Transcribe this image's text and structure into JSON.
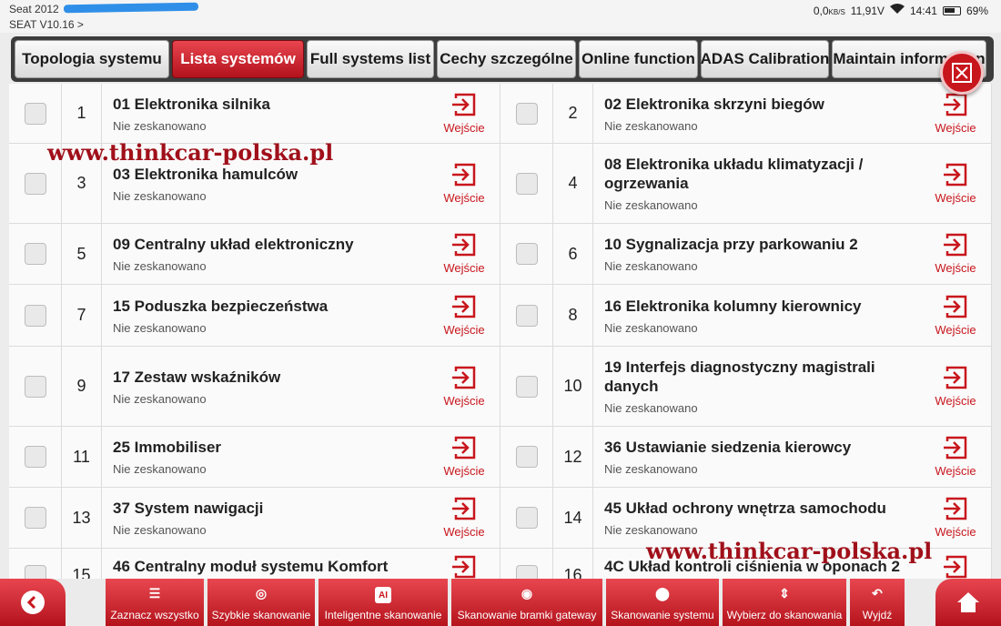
{
  "status_bar": {
    "line1": "Seat  2012",
    "line2": "SEAT V10.16 >",
    "net": "0,0",
    "net_unit": "KB/S",
    "voltage": "11,91V",
    "time": "14:41",
    "battery": "69%"
  },
  "tabs": [
    {
      "label": "Topologia systemu",
      "active": false
    },
    {
      "label": "Lista systemów",
      "active": true
    },
    {
      "label": "Full systems list",
      "active": false
    },
    {
      "label": "Cechy szczególne",
      "active": false
    },
    {
      "label": "Online function",
      "active": false
    },
    {
      "label": "ADAS Calibration",
      "active": false
    },
    {
      "label": "Maintain information",
      "active": false
    }
  ],
  "entry_label": "Wejście",
  "status_label": "Nie zeskanowano",
  "systems": [
    {
      "no": "1",
      "name": "01 Elektronika silnika"
    },
    {
      "no": "2",
      "name": "02 Elektronika skrzyni biegów"
    },
    {
      "no": "3",
      "name": "03 Elektronika hamulców"
    },
    {
      "no": "4",
      "name": "08 Elektronika układu klimatyzacji / ogrzewania"
    },
    {
      "no": "5",
      "name": "09 Centralny układ elektroniczny"
    },
    {
      "no": "6",
      "name": "10 Sygnalizacja przy parkowaniu 2"
    },
    {
      "no": "7",
      "name": "15 Poduszka bezpieczeństwa"
    },
    {
      "no": "8",
      "name": "16 Elektronika kolumny kierownicy"
    },
    {
      "no": "9",
      "name": "17 Zestaw wskaźników"
    },
    {
      "no": "10",
      "name": "19 Interfejs diagnostyczny magistrali danych"
    },
    {
      "no": "11",
      "name": "25 Immobiliser"
    },
    {
      "no": "12",
      "name": "36 Ustawianie siedzenia kierowcy"
    },
    {
      "no": "13",
      "name": "37 System nawigacji"
    },
    {
      "no": "14",
      "name": "45 Układ ochrony wnętrza samochodu"
    },
    {
      "no": "15",
      "name": "46 Centralny moduł systemu Komfort"
    },
    {
      "no": "16",
      "name": "4C Układ kontroli ciśnienia w oponach 2"
    }
  ],
  "watermark": "www.thinkcar-polska.pl",
  "bottom_buttons": [
    {
      "label": "Zaznacz wszystko",
      "icon": "checklist-icon"
    },
    {
      "label": "Szybkie skanowanie",
      "icon": "quick-scan-icon"
    },
    {
      "label": "Inteligentne skanowanie",
      "icon": "ai-icon",
      "glyph": "AI"
    },
    {
      "label": "Skanowanie bramki gateway",
      "icon": "gateway-icon"
    },
    {
      "label": "Skanowanie systemu",
      "icon": "system-scan-icon"
    },
    {
      "label": "Wybierz do skanowania",
      "icon": "select-icon"
    },
    {
      "label": "Wyjdź",
      "icon": "exit-icon"
    }
  ]
}
